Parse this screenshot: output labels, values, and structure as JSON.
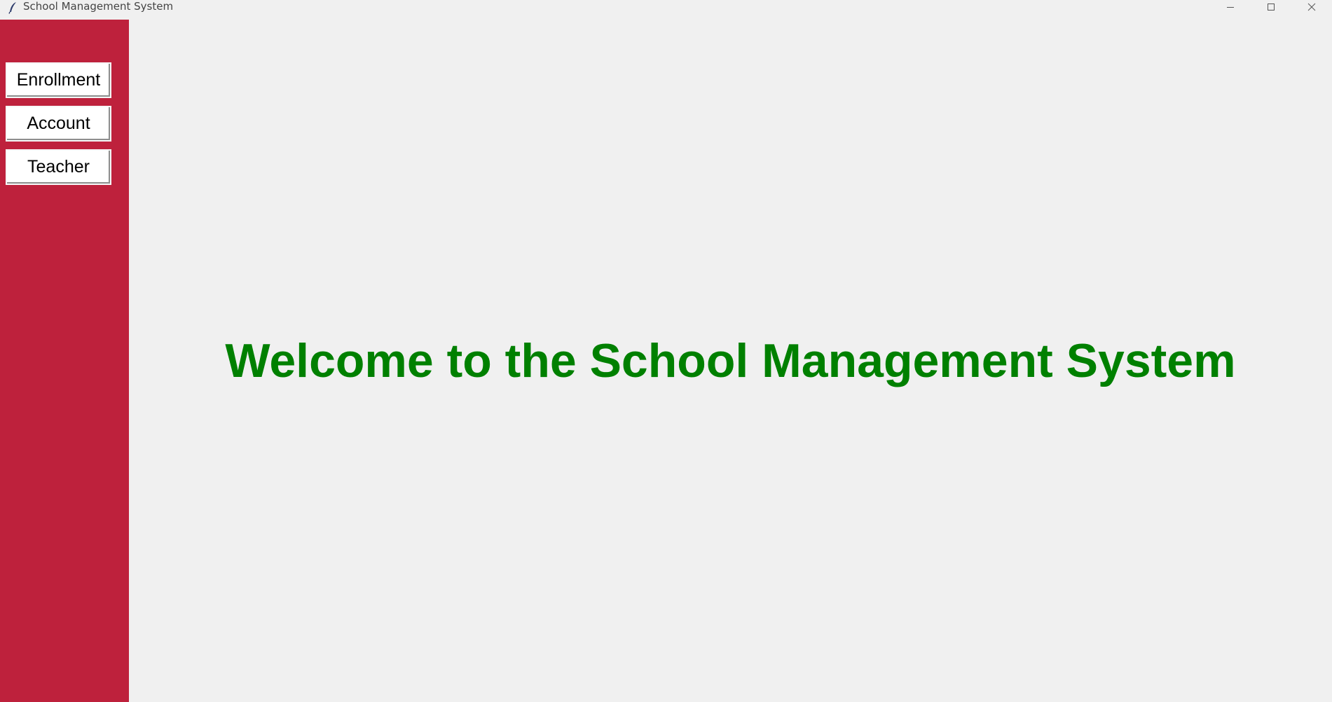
{
  "window": {
    "title": "School Management System",
    "icon": "feather-icon",
    "controls": [
      "minimize-icon",
      "maximize-icon",
      "close-icon"
    ]
  },
  "sidebar": {
    "background": "#be213c",
    "items": [
      {
        "label": "Enrollment"
      },
      {
        "label": "Account"
      },
      {
        "label": "Teacher"
      }
    ]
  },
  "main": {
    "welcome_text": "Welcome to the School Management System",
    "welcome_color": "#008000"
  }
}
